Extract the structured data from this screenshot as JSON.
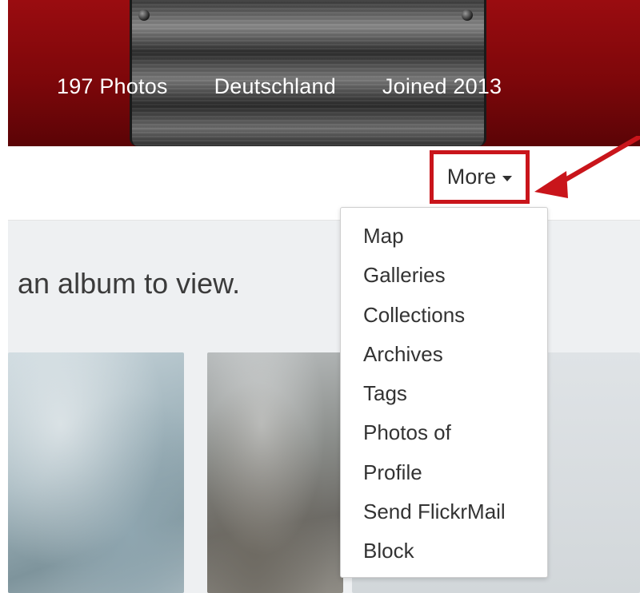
{
  "banner": {
    "stats": [
      "197 Photos",
      "Deutschland",
      "Joined 2013"
    ],
    "background_color": "#7d070a"
  },
  "content": {
    "prompt_text": "an album to view."
  },
  "more_button": {
    "label": "More",
    "icon": "caret-down-icon",
    "highlight_color": "#c9151b"
  },
  "dropdown": {
    "items": [
      "Map",
      "Galleries",
      "Collections",
      "Archives",
      "Tags",
      "Photos of",
      "Profile",
      "Send FlickrMail",
      "Block"
    ]
  },
  "annotation": {
    "arrow_color": "#c9151b",
    "icon": "annotation-arrow-icon"
  }
}
